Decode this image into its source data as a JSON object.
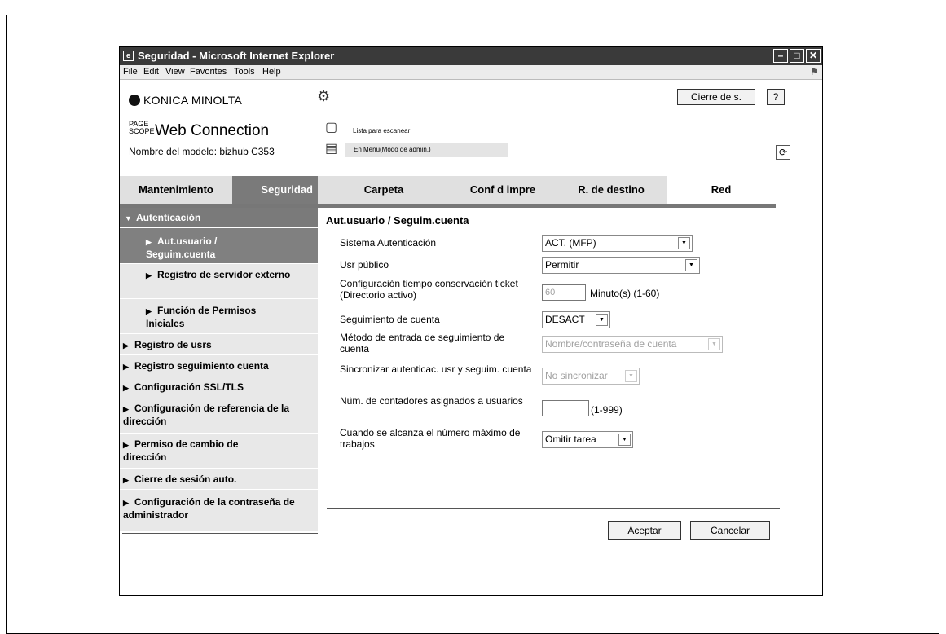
{
  "window": {
    "title": "Seguridad - Microsoft Internet Explorer"
  },
  "menu": [
    "File",
    "Edit",
    "View",
    "Favorites",
    "Tools",
    "Help"
  ],
  "header": {
    "brand": "KONICA MINOLTA",
    "product_mark": "PAGE SCOPE",
    "product": "Web Connection",
    "model_label": "Nombre del modelo: bizhub C353",
    "scan_status": "Lista para escanear",
    "admin_mode": "En Menu(Modo de admin.)",
    "logout_label": "Cierre de s.",
    "help_label": "?"
  },
  "tabs": [
    "Mantenimiento",
    "Seguridad",
    "Carpeta",
    "Conf d impre",
    "R. de destino",
    "Red"
  ],
  "sidebar": [
    {
      "label": "Autenticación"
    },
    {
      "label": "Aut.usuario / Seguim.cuenta"
    },
    {
      "label": "Registro de servidor externo"
    },
    {
      "label": "Función de Permisos Iniciales"
    },
    {
      "label": "Registro de usrs"
    },
    {
      "label": "Registro seguimiento cuenta"
    },
    {
      "label": "Configuración SSL/TLS"
    },
    {
      "label": "Configuración de referencia de la dirección"
    },
    {
      "label": "Permiso de cambio de dirección"
    },
    {
      "label": "Cierre de sesión auto."
    },
    {
      "label": "Configuración de la contraseña de administrador"
    }
  ],
  "main": {
    "title": "Aut.usuario / Seguim.cuenta",
    "fields": [
      {
        "label": "Sistema Autenticación",
        "value": "ACT. (MFP)"
      },
      {
        "label": "Usr público",
        "value": "Permitir"
      },
      {
        "label": "Configuración tiempo conservación ticket (Directorio activo)",
        "value": "60",
        "unit": "Minuto(s) (1-60)"
      },
      {
        "label": "Seguimiento de cuenta",
        "value": "DESACT"
      },
      {
        "label": "Método de entrada de seguimiento de cuenta",
        "value": "Nombre/contraseña de cuenta"
      },
      {
        "label": "Sincronizar autenticac. usr y seguim. cuenta",
        "value": "No sincronizar"
      },
      {
        "label": "Núm. de contadores asignados a usuarios",
        "value": "",
        "unit": "(1-999)"
      },
      {
        "label": "Cuando se alcanza el número máximo de trabajos",
        "value": "Omitir tarea"
      }
    ],
    "ok_label": "Aceptar",
    "cancel_label": "Cancelar"
  }
}
